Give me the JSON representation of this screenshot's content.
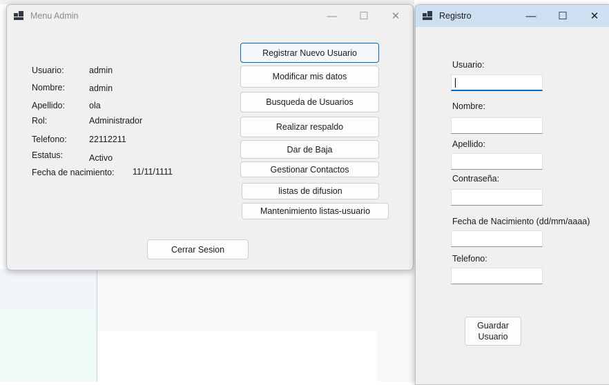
{
  "menu_window": {
    "title": "Menu Admin",
    "info": [
      {
        "label": "Usuario:",
        "value": "admin"
      },
      {
        "label": "Nombre:",
        "value": "admin"
      },
      {
        "label": "Apellido:",
        "value": "ola"
      },
      {
        "label": "Rol:",
        "value": "Administrador"
      },
      {
        "label": "Telefono:",
        "value": "22112211"
      },
      {
        "label": "Estatus:",
        "value": "Activo"
      },
      {
        "label": "Fecha de nacimiento:",
        "value": "11/11/1111"
      }
    ],
    "buttons": [
      "Registrar Nuevo Usuario",
      "Modificar mis datos",
      "Busqueda de Usuarios",
      "Realizar respaldo",
      "Dar de Baja",
      "Gestionar Contactos",
      "listas de difusion",
      "Mantenimiento listas-usuario"
    ],
    "logout_label": "Cerrar Sesion",
    "controls": {
      "minimize": "—",
      "maximize": "☐",
      "close": "✕"
    }
  },
  "register_window": {
    "title": "Registro",
    "fields": [
      {
        "label": "Usuario:",
        "value": ""
      },
      {
        "label": "Nombre:",
        "value": ""
      },
      {
        "label": "Apellido:",
        "value": ""
      },
      {
        "label": "Contraseña:",
        "value": ""
      },
      {
        "label": "Fecha de Nacimiento (dd/mm/aaaa)",
        "value": ""
      },
      {
        "label": "Telefono:",
        "value": ""
      }
    ],
    "save_label_line1": "Guardar",
    "save_label_line2": "Usuario",
    "controls": {
      "minimize": "—",
      "maximize": "☐",
      "close": "✕"
    }
  },
  "colors": {
    "accent": "#0067c0",
    "register_titlebar": "#cfdff2",
    "window_bg": "#f0f0f0"
  }
}
